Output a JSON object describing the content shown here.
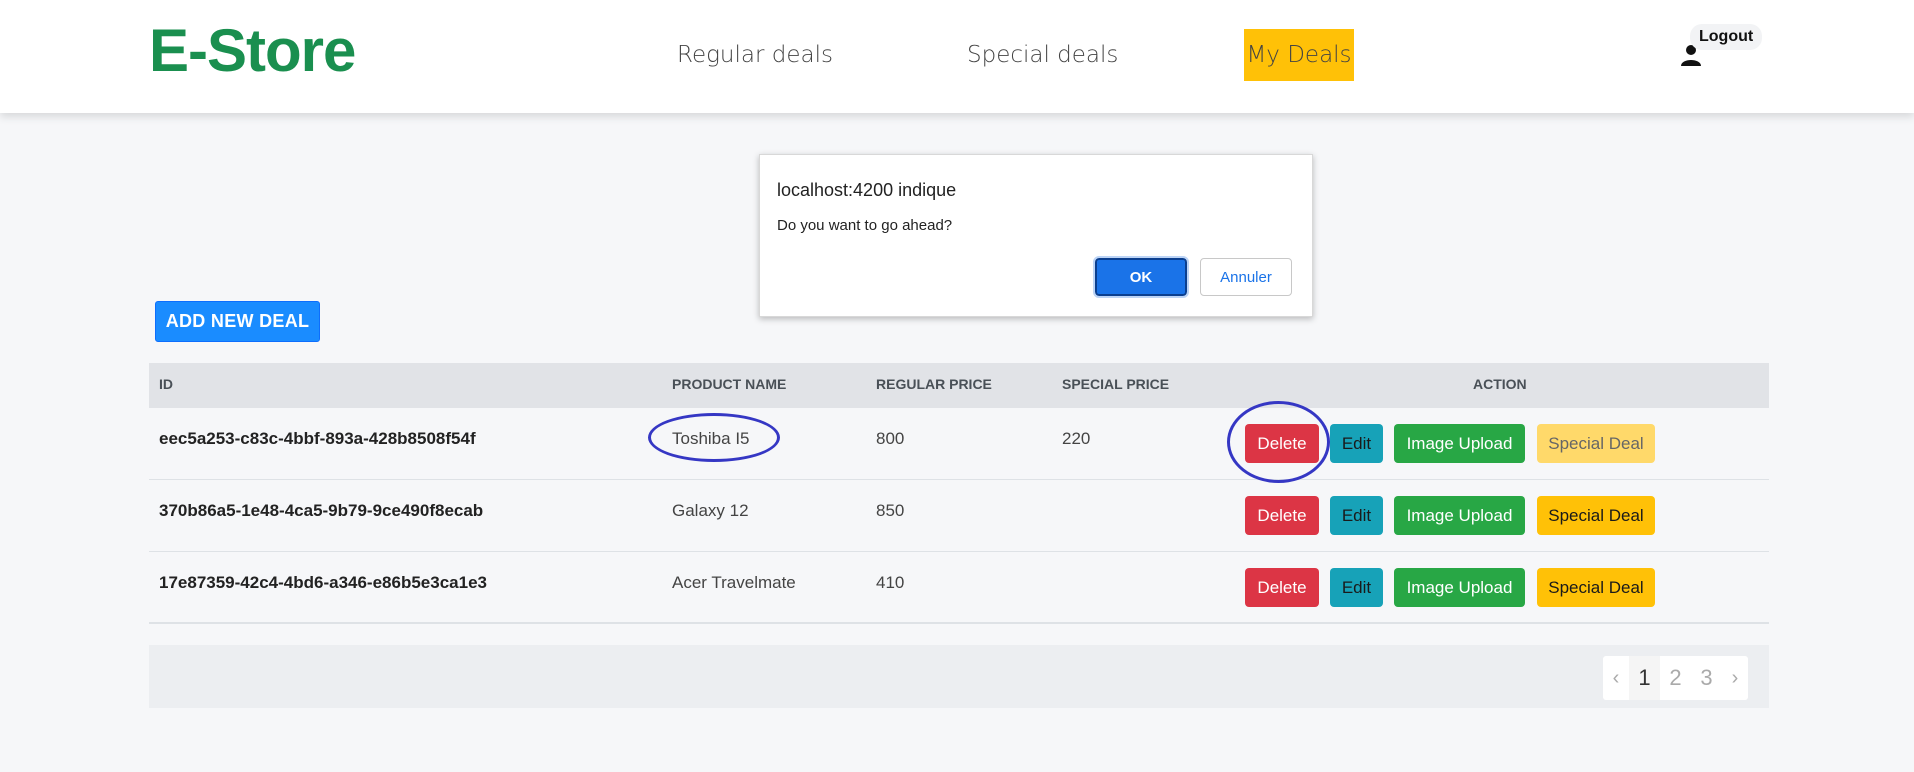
{
  "navbar": {
    "brand": "E-Store",
    "links": [
      "Regular deals",
      "Special deals",
      "My Deals"
    ],
    "active_link": "My Deals",
    "logout_label": "Logout",
    "brand_color": "#1a8f4f",
    "active_color": "#ffc107"
  },
  "dialog": {
    "title": "localhost:4200 indique",
    "message": "Do you want to go ahead?",
    "ok_label": "OK",
    "cancel_label": "Annuler"
  },
  "add_button": "ADD NEW DEAL",
  "table": {
    "headers": [
      "ID",
      "PRODUCT NAME",
      "REGULAR PRICE",
      "SPECIAL PRICE",
      "ACTION"
    ],
    "rows": [
      {
        "id": "eec5a253-c83c-4bbf-893a-428b8508f54f",
        "name": "Toshiba I5",
        "regular": "800",
        "special": "220"
      },
      {
        "id": "370b86a5-1e48-4ca5-9b79-9ce490f8ecab",
        "name": "Galaxy 12",
        "regular": "850",
        "special": ""
      },
      {
        "id": "17e87359-42c4-4bd6-a346-e86b5e3ca1e3",
        "name": "Acer Travelmate",
        "regular": "410",
        "special": ""
      }
    ],
    "actions": {
      "delete": "Delete",
      "edit": "Edit",
      "upload": "Image Upload",
      "special": "Special Deal"
    }
  },
  "pagination": {
    "prev": "‹",
    "pages": [
      "1",
      "2",
      "3"
    ],
    "next": "›",
    "current": "1"
  }
}
